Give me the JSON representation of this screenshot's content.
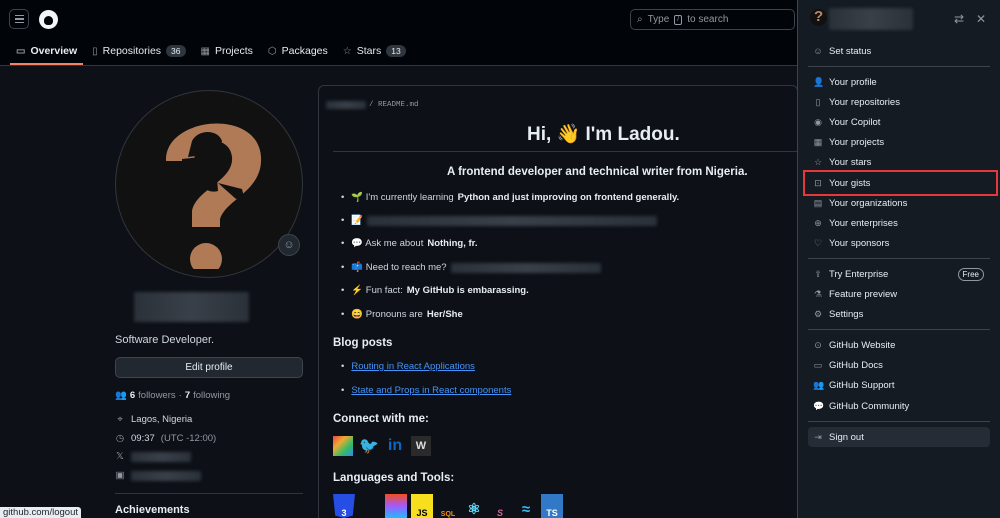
{
  "header": {
    "search_placeholder_pre": "Type",
    "search_key": "/",
    "search_placeholder_post": "to search"
  },
  "tabs": [
    {
      "label": "Overview",
      "icon": "book-icon",
      "count": null
    },
    {
      "label": "Repositories",
      "icon": "repo-icon",
      "count": "36"
    },
    {
      "label": "Projects",
      "icon": "table-icon",
      "count": null
    },
    {
      "label": "Packages",
      "icon": "package-icon",
      "count": null
    },
    {
      "label": "Stars",
      "icon": "star-icon",
      "count": "13"
    }
  ],
  "profile": {
    "bio": "Software Developer.",
    "edit_label": "Edit profile",
    "followers_count": "6",
    "followers_label": "followers",
    "following_count": "7",
    "following_label": "following",
    "location": "Lagos, Nigeria",
    "time": "09:37",
    "timezone": "(UTC -12:00)",
    "achievements_label": "Achievements"
  },
  "readme": {
    "path": "/ README.md",
    "title": "Hi, 👋 I'm Ladou.",
    "tagline": "A frontend developer and technical writer from Nigeria.",
    "items": {
      "learning_pre": "🌱 I'm currently learning",
      "learning_bold": "Python and just improving on frontend generally.",
      "writing": "📝",
      "ask_pre": "💬 Ask me about",
      "ask_bold": "Nothing, fr.",
      "reach": "📫 Need to reach me?",
      "fun_pre": "⚡ Fun fact:",
      "fun_bold": "My GitHub is embarassing.",
      "pronouns_pre": "😄 Pronouns are",
      "pronouns_bold": "Her/She"
    },
    "blog_heading": "Blog posts",
    "blog_links": [
      "Routing in React Applications",
      "State and Props in React components"
    ],
    "connect_heading": "Connect with me:",
    "tools_heading": "Languages and Tools:"
  },
  "statusbar": "github.com/logout",
  "menu": {
    "set_status": "Set status",
    "group1": [
      "Your profile",
      "Your repositories",
      "Your Copilot",
      "Your projects",
      "Your stars",
      "Your gists",
      "Your organizations",
      "Your enterprises",
      "Your sponsors"
    ],
    "try_enterprise": "Try Enterprise",
    "free_badge": "Free",
    "feature_preview": "Feature preview",
    "settings": "Settings",
    "group3": [
      "GitHub Website",
      "GitHub Docs",
      "GitHub Support",
      "GitHub Community"
    ],
    "sign_out": "Sign out",
    "highlight_color": "#e5383b"
  }
}
